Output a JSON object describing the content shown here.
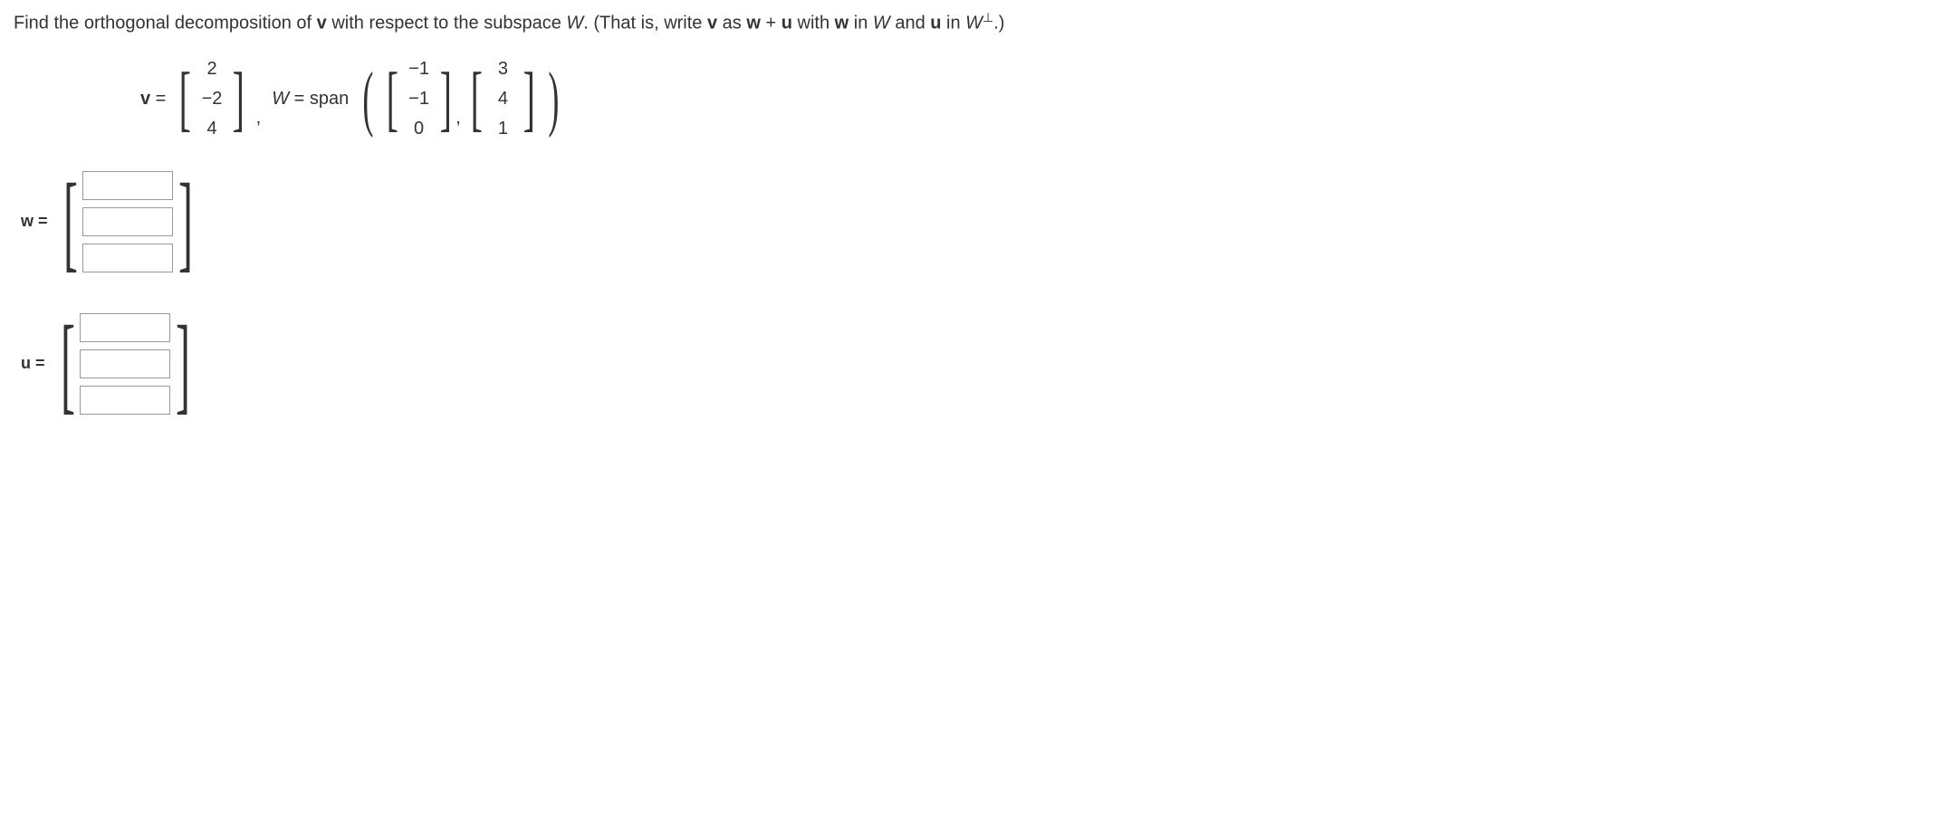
{
  "problem": {
    "text_part1": "Find the orthogonal decomposition of ",
    "v_bold": "v",
    "text_part2": " with respect to the subspace ",
    "W_italic": "W",
    "text_part3": ". (That is, write ",
    "text_part4": " as ",
    "w_bold": "w",
    "plus": " + ",
    "u_bold": "u",
    "text_part5": " with ",
    "text_part6": " in ",
    "text_part7": " and ",
    "text_part8": " in ",
    "W_perp": "W",
    "perp_symbol": "⊥",
    "text_part9": ".)"
  },
  "given": {
    "v_label": "v",
    "equals": " = ",
    "v_vector": [
      "2",
      "−2",
      "4"
    ],
    "comma": ",",
    "W_label": "W",
    "span_label": " = span",
    "basis1": [
      "−1",
      "−1",
      "0"
    ],
    "basis2": [
      "3",
      "4",
      "1"
    ]
  },
  "answers": {
    "w_label": "w = ",
    "u_label": "u = ",
    "w_values": [
      "",
      "",
      ""
    ],
    "u_values": [
      "",
      "",
      ""
    ]
  }
}
